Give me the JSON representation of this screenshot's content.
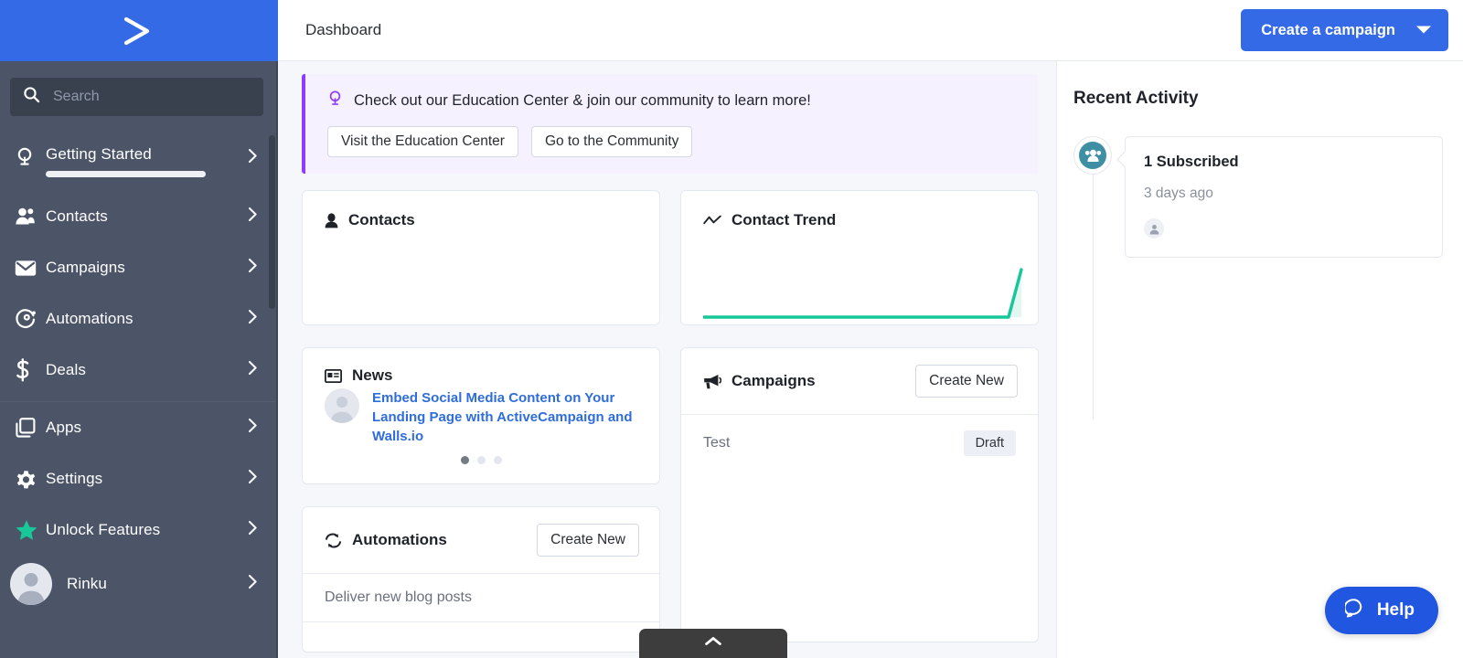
{
  "brand": {
    "logo_icon": "activecampaign-chevron-logo"
  },
  "sidebar": {
    "search": {
      "value": "",
      "placeholder": "Search",
      "icon": "search-icon"
    },
    "items_top": [
      {
        "label": "Getting Started",
        "icon": "lightbulb-icon",
        "progress_percent": 33
      },
      {
        "label": "Contacts",
        "icon": "contacts-icon"
      },
      {
        "label": "Campaigns",
        "icon": "envelope-icon"
      },
      {
        "label": "Automations",
        "icon": "automations-gear-circle-icon"
      },
      {
        "label": "Deals",
        "icon": "dollar-icon"
      }
    ],
    "items_bottom": [
      {
        "label": "Apps",
        "icon": "apps-squares-icon"
      },
      {
        "label": "Settings",
        "icon": "gear-icon"
      },
      {
        "label": "Unlock Features",
        "icon": "star-icon"
      }
    ],
    "user": {
      "label": "Rinku",
      "icon": "avatar-icon"
    },
    "chevron_icon": "chevron-right-icon",
    "accent_green": "#17c898",
    "background": "#4c5468",
    "brand_blue": "#356ae6"
  },
  "topbar": {
    "title": "Dashboard",
    "cta_label": "Create a campaign",
    "cta_caret_icon": "caret-down-icon",
    "cta_color": "#356ae6"
  },
  "banner": {
    "icon": "lightbulb-icon",
    "text": "Check out our Education Center & join our community to learn more!",
    "buttons": [
      {
        "label": "Visit the Education Center"
      },
      {
        "label": "Go to the Community"
      }
    ],
    "accent": "#8e3dff",
    "background": "#f6f1ff"
  },
  "cards": {
    "contacts": {
      "title": "Contacts",
      "icon": "person-icon"
    },
    "contact_trend": {
      "title": "Contact Trend",
      "icon": "trend-line-icon",
      "line_color": "#16c79a"
    },
    "news": {
      "title": "News",
      "icon": "news-card-icon",
      "avatar_icon": "avatar-icon",
      "headline": "Embed Social Media Content on Your Landing Page with ActiveCampaign and Walls.io",
      "dots": 3,
      "active_dot": 0
    },
    "campaigns": {
      "title": "Campaigns",
      "icon": "megaphone-icon",
      "create_label": "Create New",
      "rows": [
        {
          "name": "Test",
          "status": "Draft"
        }
      ]
    },
    "automations": {
      "title": "Automations",
      "icon": "refresh-icon",
      "create_label": "Create New",
      "rows": [
        {
          "name": "Deliver new blog posts"
        }
      ]
    }
  },
  "chart_data": {
    "type": "line",
    "title": "Contact Trend",
    "xlabel": "",
    "ylabel": "",
    "x": [
      0,
      1,
      2,
      3,
      4,
      5,
      6,
      7,
      8,
      9,
      10,
      11
    ],
    "values": [
      0,
      0,
      0,
      0,
      0,
      0,
      0,
      0,
      0,
      0,
      0,
      1
    ],
    "ylim": [
      0,
      1
    ],
    "grid": false,
    "legend": "none",
    "line_color": "#16c79a",
    "fill_color": "#e2f7f1"
  },
  "activity": {
    "title": "Recent Activity",
    "items": [
      {
        "icon": "contacts-group-icon",
        "headline": "1 Subscribed",
        "time": "3 days ago",
        "contact_icon": "avatar-icon"
      }
    ]
  },
  "floating": {
    "help_label": "Help",
    "help_icon": "chat-bubble-icon",
    "help_color": "#2056e0",
    "bottom_tab_icon": "chevron-up-icon"
  }
}
